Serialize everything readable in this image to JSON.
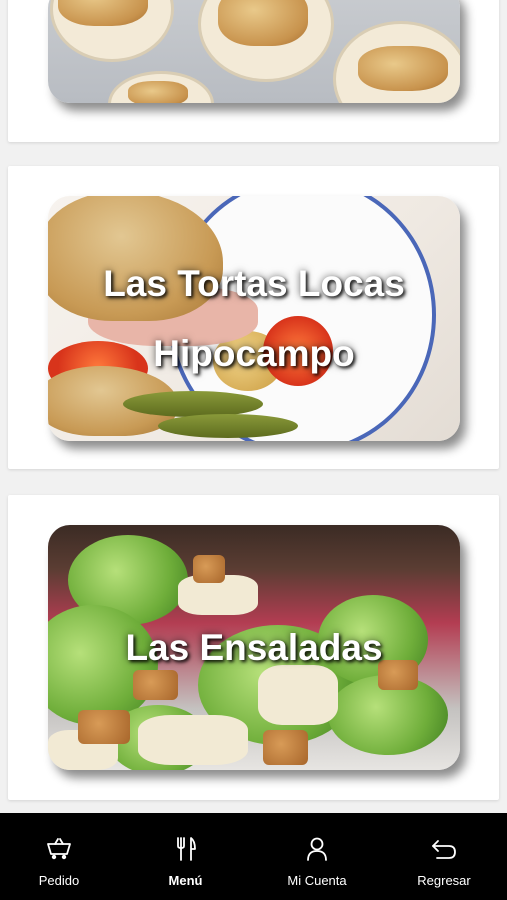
{
  "categories": [
    {
      "title_lines": [],
      "image": "breads-plates-photo"
    },
    {
      "title_lines": [
        "Las Tortas Locas",
        "Hipocampo"
      ],
      "image": "torta-plate-photo"
    },
    {
      "title_lines": [
        "Las Ensaladas"
      ],
      "image": "caesar-salad-photo"
    }
  ],
  "bottom_nav": {
    "items": [
      {
        "label": "Pedido",
        "icon": "cart-icon",
        "active": false
      },
      {
        "label": "Menú",
        "icon": "fork-knife-icon",
        "active": true
      },
      {
        "label": "Mi Cuenta",
        "icon": "user-icon",
        "active": false
      },
      {
        "label": "Regresar",
        "icon": "back-arrow-icon",
        "active": false
      }
    ]
  },
  "colors": {
    "nav_bg": "#000000",
    "card_bg": "#ffffff",
    "page_bg": "#f1f1f1"
  }
}
